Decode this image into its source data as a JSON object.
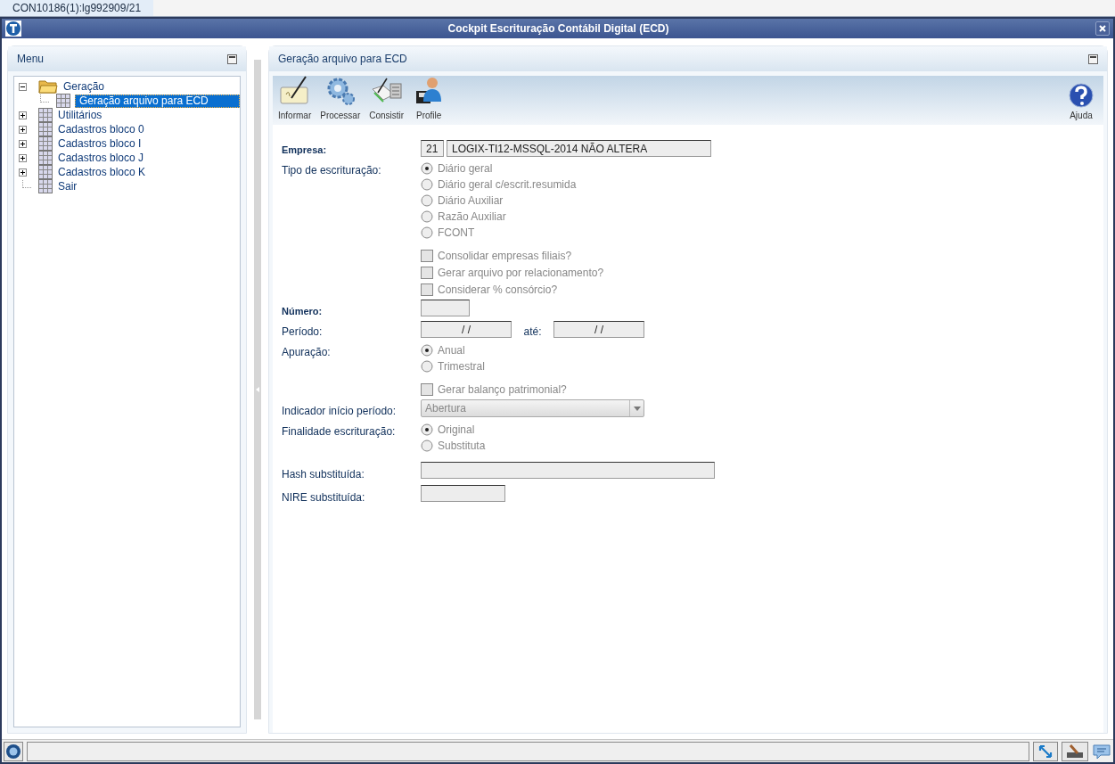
{
  "tab": {
    "label": "CON10186(1):lg992909/21",
    "selected": true
  },
  "window": {
    "title": "Cockpit Escrituração Contábil Digital (ECD)"
  },
  "menu": {
    "title": "Menu",
    "tree": [
      {
        "label": "Geração",
        "kind": "folder",
        "expanded": true,
        "selected": false,
        "children": [
          {
            "label": "Geração arquivo para ECD",
            "kind": "grid",
            "selected": true
          }
        ]
      },
      {
        "label": "Utilitários",
        "kind": "grid",
        "expanded": false,
        "selected": false
      },
      {
        "label": "Cadastros bloco 0",
        "kind": "grid",
        "expanded": false,
        "selected": false
      },
      {
        "label": "Cadastros bloco I",
        "kind": "grid",
        "expanded": false,
        "selected": false
      },
      {
        "label": "Cadastros bloco J",
        "kind": "grid",
        "expanded": false,
        "selected": false
      },
      {
        "label": "Cadastros bloco K",
        "kind": "grid",
        "expanded": false,
        "selected": false
      },
      {
        "label": "Sair",
        "kind": "grid",
        "selected": false
      }
    ]
  },
  "panel": {
    "title": "Geração arquivo para ECD",
    "toolbar": [
      {
        "label": "Informar",
        "kind": "write"
      },
      {
        "label": "Processar",
        "kind": "gears"
      },
      {
        "label": "Consistir",
        "kind": "check"
      },
      {
        "label": "Profile",
        "kind": "profile"
      }
    ],
    "help": {
      "label": "Ajuda"
    },
    "form": [
      {
        "kind": "company",
        "label": "Empresa:",
        "required": true,
        "code": "21",
        "value": "LOGIX-TI12-MSSQL-2014 NÃO ALTERA"
      },
      {
        "kind": "radios",
        "label": "Tipo de escrituração:",
        "options": [
          {
            "label": "Diário geral",
            "selected": true
          },
          {
            "label": "Diário geral c/escrit.resumida",
            "selected": false
          },
          {
            "label": "Diário Auxiliar",
            "selected": false
          },
          {
            "label": "Razão Auxiliar",
            "selected": false
          },
          {
            "label": "FCONT",
            "selected": false
          }
        ]
      },
      {
        "kind": "checkbox",
        "label": "Consolidar empresas filiais?",
        "checked": false
      },
      {
        "kind": "checkbox",
        "label": "Gerar arquivo por relacionamento?",
        "checked": false
      },
      {
        "kind": "checkbox",
        "label": "Considerar % consórcio?",
        "checked": false
      },
      {
        "kind": "short_field",
        "label": "Número:",
        "required": true
      },
      {
        "kind": "date_range",
        "label": "Período:",
        "from": "/ /",
        "to_label": "até:",
        "to": "/ /"
      },
      {
        "kind": "radios",
        "label": "Apuração:",
        "options": [
          {
            "label": "Anual",
            "selected": true
          },
          {
            "label": "Trimestral",
            "selected": false
          }
        ]
      },
      {
        "kind": "checkbox",
        "label": "Gerar balanço patrimonial?",
        "checked": false
      },
      {
        "kind": "select",
        "label": "Indicador início período:",
        "value": "Abertura"
      },
      {
        "kind": "radios",
        "label": "Finalidade escrituração:",
        "options": [
          {
            "label": "Original",
            "selected": true
          },
          {
            "label": "Substituta",
            "selected": false
          }
        ]
      },
      {
        "kind": "long_field",
        "label": "Hash substituída:"
      },
      {
        "kind": "medium_field",
        "label": "NIRE substituída:"
      }
    ]
  }
}
